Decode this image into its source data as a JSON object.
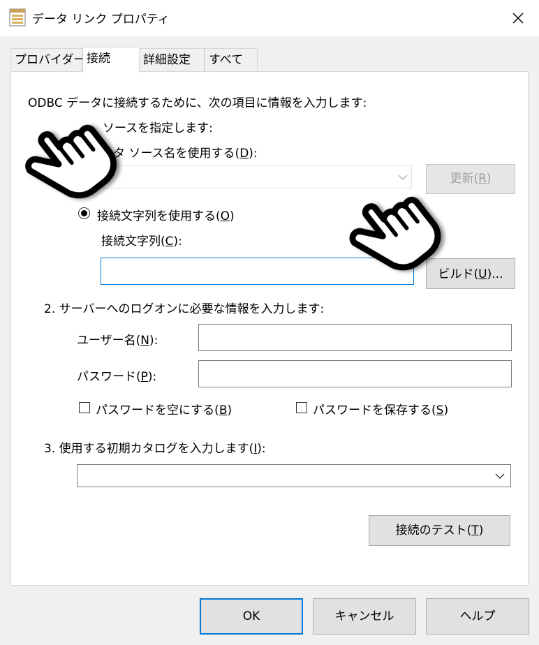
{
  "window": {
    "title": "データ リンク プロパティ",
    "icon": "database-properties-icon"
  },
  "tabs": [
    {
      "label": "プロバイダー",
      "active": false
    },
    {
      "label": "接続",
      "active": true
    },
    {
      "label": "詳細設定",
      "active": false
    },
    {
      "label": "すべて",
      "active": false
    }
  ],
  "intro": "ODBC データに接続するために、次の項目に情報を入力します:",
  "step1": {
    "label": "ソースを指定します:",
    "dsn_radio_label": "ータ ソース名を使用する(",
    "dsn_radio_key": "D",
    "dsn_radio_suffix": "):",
    "refresh_button": {
      "label": "更新(",
      "key": "R",
      "suffix": ")"
    },
    "conn_radio": {
      "label": "接続文字列を使用する(",
      "key": "O",
      "suffix": ")",
      "selected": true
    },
    "conn_string_label": {
      "label": "接続文字列(",
      "key": "C",
      "suffix": "):"
    },
    "conn_string_value": "",
    "build_button": {
      "label": "ビルド(",
      "key": "U",
      "suffix": ")..."
    }
  },
  "step2": {
    "label": "2. サーバーへのログオンに必要な情報を入力します:",
    "user_label": {
      "label": "ユーザー名(",
      "key": "N",
      "suffix": "):"
    },
    "user_value": "",
    "password_label": {
      "label": "パスワード(",
      "key": "P",
      "suffix": "):"
    },
    "password_value": "",
    "blank_password": {
      "label": "パスワードを空にする(",
      "key": "B",
      "suffix": ")",
      "checked": false
    },
    "save_password": {
      "label": "パスワードを保存する(",
      "key": "S",
      "suffix": ")",
      "checked": false
    }
  },
  "step3": {
    "label": "3. 使用する初期カタログを入力します(",
    "key": "I",
    "suffix": "):",
    "catalog_value": ""
  },
  "test_button": {
    "label": "接続のテスト(",
    "key": "T",
    "suffix": ")"
  },
  "footer": {
    "ok": "OK",
    "cancel": "キャンセル",
    "help": "ヘルプ"
  },
  "overlays": [
    "pointing-hand-icon",
    "pointing-hand-icon"
  ],
  "colors": {
    "accent": "#0078d7",
    "panel": "#ffffff",
    "dialog": "#f0f0f0"
  }
}
